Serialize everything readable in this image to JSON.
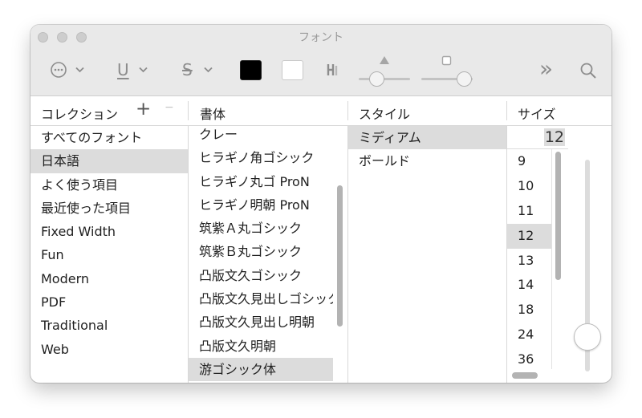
{
  "window": {
    "title": "フォント"
  },
  "toolbar": {
    "action_glyph": "⋯",
    "underline_glyph": "U",
    "strike_glyph": "S",
    "chevron": "⌄",
    "text_color": "#000000",
    "doc_color": "#ffffff",
    "more_glyph": "»",
    "search_glyph": "⌕"
  },
  "columns": {
    "collection": "コレクション",
    "add": "+",
    "remove": "−",
    "family": "書体",
    "style": "スタイル",
    "size": "サイズ"
  },
  "collections": [
    "すべてのフォント",
    "日本語",
    "よく使う項目",
    "最近使った項目",
    "Fixed Width",
    "Fun",
    "Modern",
    "PDF",
    "Traditional",
    "Web"
  ],
  "collections_selected": 1,
  "families": [
    "クレー",
    "ヒラギノ角ゴシック",
    "ヒラギノ丸ゴ ProN",
    "ヒラギノ明朝 ProN",
    "筑紫Ａ丸ゴシック",
    "筑紫Ｂ丸ゴシック",
    "凸版文久ゴシック",
    "凸版文久見出しゴシック",
    "凸版文久見出し明朝",
    "凸版文久明朝",
    "游ゴシック体"
  ],
  "families_selected": 10,
  "styles": [
    "ミディアム",
    "ボールド"
  ],
  "styles_selected": 0,
  "size_value": "12",
  "sizes": [
    "9",
    "10",
    "11",
    "12",
    "13",
    "14",
    "18",
    "24",
    "36"
  ],
  "sizes_selected": 3
}
